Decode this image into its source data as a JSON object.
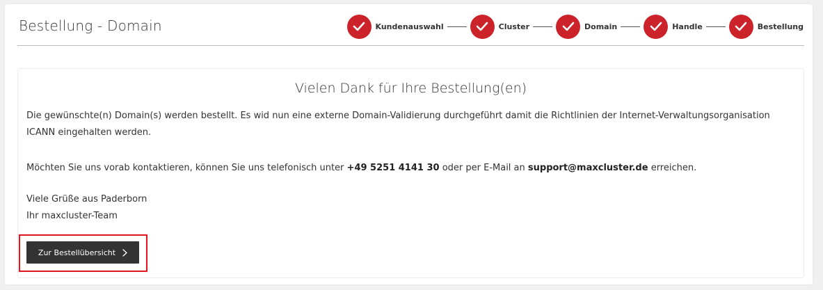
{
  "page": {
    "title": "Bestellung - Domain"
  },
  "steps": [
    {
      "label": "Kundenauswahl",
      "state": "done"
    },
    {
      "label": "Cluster",
      "state": "done"
    },
    {
      "label": "Domain",
      "state": "done"
    },
    {
      "label": "Handle",
      "state": "done"
    },
    {
      "label": "Bestellung",
      "state": "done"
    }
  ],
  "card": {
    "title": "Vielen Dank für Ihre Bestellung(en)",
    "paragraph1": "Die gewünschte(n) Domain(s) werden bestellt. Es wid nun eine externe Domain-Validierung durchgeführt damit die Richtlinien der Internet-Verwaltungsorganisation ICANN eingehalten werden.",
    "contact": {
      "before": "Möchten Sie uns vorab kontaktieren, können Sie uns telefonisch unter ",
      "phone": "+49 5251 4141 30",
      "middle": " oder per E-Mail an ",
      "email": "support@maxcluster.de",
      "after": " erreichen."
    },
    "greeting": "Viele Grüße aus Paderborn",
    "signature": "Ihr maxcluster-Team",
    "button_label": "Zur Bestellübersicht"
  },
  "colors": {
    "accent": "#cc2229",
    "button_bg": "#333333",
    "highlight": "#e8111c",
    "background": "#f0f0f0"
  },
  "icons": {
    "step": "check-icon",
    "button": "chevron-right-icon"
  }
}
